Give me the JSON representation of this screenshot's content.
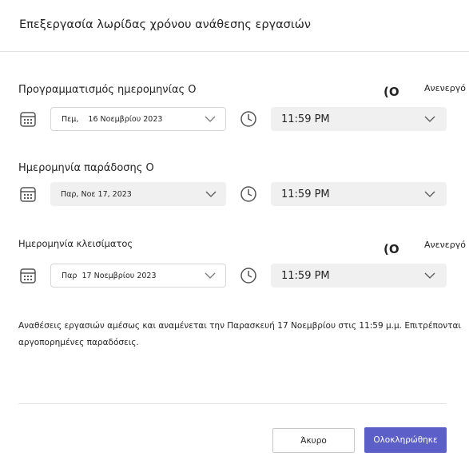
{
  "dialog": {
    "title": "Επεξεργασία λωρίδας χρόνου ανάθεσης εργασιών"
  },
  "schedule": {
    "label": "Προγραμματισμός ημερομηνίας Ο",
    "toggle_glyph": "(O",
    "toggle_text": "Ανενεργό",
    "date": "Πεμ,    16 Νοεμβρίου 2023",
    "time": "11:59 PM"
  },
  "due": {
    "label": "Ημερομηνία παράδοσης Ο",
    "date": "Παρ, Νοε 17, 2023",
    "time": "11:59 PM"
  },
  "close": {
    "label": "Ημερομηνία κλεισίματος",
    "toggle_glyph": "(O",
    "toggle_text": "Ανενεργό",
    "date": "Παρ  17 Νοεμβρίου 2023",
    "time": "11:59 PM"
  },
  "summary": "Αναθέσεις εργασιών αμέσως και αναμένεται την Παρασκευή 17 Νοεμβρίου στις 11:59 μ.μ. Επιτρέπονται αργοπορημένες παραδόσεις.",
  "buttons": {
    "cancel": "Άκυρο",
    "done": "Ολοκληρώθηκε"
  },
  "colors": {
    "primary": "#5b5fc7",
    "field_bg": "#f0f0f0",
    "divider": "#e2e2e2"
  },
  "icons": [
    "calendar-icon",
    "clock-icon",
    "chevron-down-icon"
  ]
}
